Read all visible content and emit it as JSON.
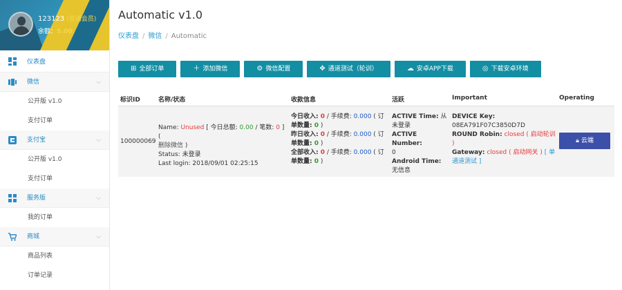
{
  "user": {
    "name": "123123",
    "role": "(普通会员)",
    "balance_label": "余额：",
    "balance": "5.00"
  },
  "sidebar": {
    "items": [
      {
        "label": "仪表盘"
      },
      {
        "label": "微信",
        "subs": [
          "公开版 v1.0",
          "支付订单"
        ]
      },
      {
        "label": "支付宝",
        "subs": [
          "公开版 v1.0",
          "支付订单"
        ]
      },
      {
        "label": "服务版",
        "subs": [
          "我的订单"
        ]
      },
      {
        "label": "商城",
        "subs": [
          "商品列表",
          "订单记录"
        ]
      }
    ]
  },
  "header": {
    "title": "Automatic v1.0",
    "breadcrumb": [
      "仪表盘",
      "微信",
      "Automatic"
    ]
  },
  "toolbar": {
    "buttons": [
      "全部订单",
      "添加微信",
      "微信配置",
      "通道测试（轮训）",
      "安卓APP下载",
      "下载安卓环境"
    ]
  },
  "table": {
    "headers": [
      "标识ID",
      "名称/状态",
      "收款信息",
      "活跃",
      "Important",
      "Operating"
    ],
    "row": {
      "id": "100000069",
      "name_label": "Name: ",
      "name_value": "Unused",
      "name_extra1": " [ 今日总额: ",
      "today_total": "0.00",
      "name_extra2": " / 笔数: ",
      "today_count": "0",
      "name_extra3": " ] ( ",
      "delete_link": "删除微信",
      "name_extra4": " )",
      "status": "Status: 未登录",
      "last_login": "Last login: 2018/09/01 02:25:15",
      "today_income_label": "今日收入: ",
      "today_income": "0",
      "fee_label": " / 手续费: ",
      "today_fee": "0.000",
      "order_label_a": " ( 订",
      "order_label_b": "单数量: ",
      "today_orders": "0",
      "order_label_c": " )",
      "yest_income_label": "昨日收入: ",
      "yest_income": "0",
      "yest_fee": "0.000",
      "yest_orders": "0",
      "all_income_label": "全部收入: ",
      "all_income": "0",
      "all_fee": "0.000",
      "all_orders": "0",
      "active_time_label": "ACTIVE Time:",
      "active_time_value": " 从未登录",
      "active_number_label": "ACTIVE Number:",
      "active_number_value": " 0",
      "android_time_label": "Android Time:",
      "android_time_value": " 无信息",
      "device_key_label": "DEVICE Key:",
      "device_key": "08EA791F07C3850D7D",
      "round_robin_label": "ROUND Robin:",
      "round_robin_status": "closed",
      "round_robin_action": "( 启动轮训 )",
      "gateway_label": "Gateway:",
      "gateway_status": "closed",
      "gateway_action": "( 启动网关 )",
      "gateway_test": "[ 单通道测试 ]",
      "op_button": "云端"
    }
  },
  "colors": {
    "accent": "#138ea3",
    "op_button": "#3c4fa9",
    "link": "#2a9bd6",
    "red": "#e4393c",
    "green": "#2a9b2a",
    "blue": "#1b57c4"
  }
}
